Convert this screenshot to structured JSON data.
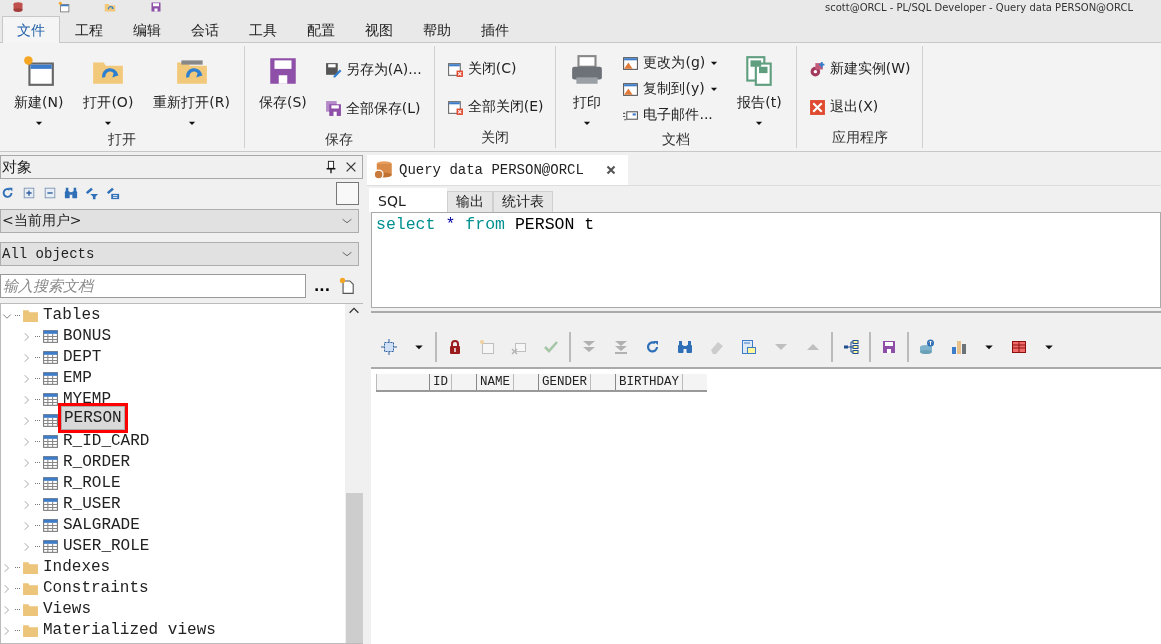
{
  "title_bar": {
    "title": "scott@ORCL - PL/SQL Developer - Query data PERSON@ORCL"
  },
  "menu_tabs": [
    {
      "label": "文件",
      "selected": true
    },
    {
      "label": "工程",
      "selected": false
    },
    {
      "label": "编辑",
      "selected": false
    },
    {
      "label": "会话",
      "selected": false
    },
    {
      "label": "工具",
      "selected": false
    },
    {
      "label": "配置",
      "selected": false
    },
    {
      "label": "视图",
      "selected": false
    },
    {
      "label": "帮助",
      "selected": false
    },
    {
      "label": "插件",
      "selected": false
    }
  ],
  "ribbon": [
    {
      "label": "打开",
      "items": [
        {
          "kind": "large",
          "label": "新建(N)",
          "dropdown": true
        },
        {
          "kind": "large",
          "label": "打开(O)",
          "dropdown": true
        },
        {
          "kind": "large",
          "label": "重新打开(R)",
          "dropdown": true
        }
      ]
    },
    {
      "label": "保存",
      "items": [
        {
          "kind": "large",
          "label": "保存(S)",
          "dropdown": false
        },
        {
          "kind": "stack",
          "items": [
            {
              "label": "另存为(A)...",
              "dropdown": false
            },
            {
              "label": "全部保存(L)",
              "dropdown": false
            }
          ]
        }
      ]
    },
    {
      "label": "关闭",
      "items": [
        {
          "kind": "stack",
          "items": [
            {
              "label": "关闭(C)",
              "dropdown": false
            },
            {
              "label": "全部关闭(E)",
              "dropdown": false
            }
          ]
        }
      ]
    },
    {
      "label": "文档",
      "items": [
        {
          "kind": "large",
          "label": "打印",
          "dropdown": true
        },
        {
          "kind": "stack",
          "items": [
            {
              "label": "更改为(g)",
              "dropdown": true
            },
            {
              "label": "复制到(y)",
              "dropdown": true
            },
            {
              "label": "电子邮件...",
              "dropdown": false
            }
          ]
        },
        {
          "kind": "large",
          "label": "报告(t)",
          "dropdown": true
        }
      ]
    },
    {
      "label": "应用程序",
      "items": [
        {
          "kind": "stack",
          "items": [
            {
              "label": "新建实例(W)",
              "dropdown": false
            },
            {
              "label": "退出(X)",
              "dropdown": false
            }
          ]
        }
      ]
    }
  ],
  "object_panel": {
    "title": "对象",
    "toggle": {
      "checked": false
    },
    "owner_select": "<当前用户>",
    "type_select": "All objects",
    "search": {
      "placeholder": "输入搜索文档"
    },
    "more_button": "...",
    "tree": [
      {
        "label": "Tables",
        "kind": "folder",
        "expanded": true,
        "selected": false,
        "highlighted": false,
        "children": [
          {
            "label": "BONUS",
            "kind": "table",
            "expanded": false,
            "selected": false,
            "highlighted": false
          },
          {
            "label": "DEPT",
            "kind": "table",
            "expanded": false,
            "selected": false,
            "highlighted": false
          },
          {
            "label": "EMP",
            "kind": "table",
            "expanded": false,
            "selected": false,
            "highlighted": false
          },
          {
            "label": "MYEMP",
            "kind": "table",
            "expanded": false,
            "selected": false,
            "highlighted": false
          },
          {
            "label": "PERSON",
            "kind": "table",
            "expanded": false,
            "selected": true,
            "highlighted": true
          },
          {
            "label": "R_ID_CARD",
            "kind": "table",
            "expanded": false,
            "selected": false,
            "highlighted": false
          },
          {
            "label": "R_ORDER",
            "kind": "table",
            "expanded": false,
            "selected": false,
            "highlighted": false
          },
          {
            "label": "R_ROLE",
            "kind": "table",
            "expanded": false,
            "selected": false,
            "highlighted": false
          },
          {
            "label": "R_USER",
            "kind": "table",
            "expanded": false,
            "selected": false,
            "highlighted": false
          },
          {
            "label": "SALGRADE",
            "kind": "table",
            "expanded": false,
            "selected": false,
            "highlighted": false
          },
          {
            "label": "USER_ROLE",
            "kind": "table",
            "expanded": false,
            "selected": false,
            "highlighted": false
          }
        ]
      },
      {
        "label": "Indexes",
        "kind": "folder",
        "expanded": false,
        "selected": false,
        "highlighted": false
      },
      {
        "label": "Constraints",
        "kind": "folder",
        "expanded": false,
        "selected": false,
        "highlighted": false
      },
      {
        "label": "Views",
        "kind": "folder",
        "expanded": false,
        "selected": false,
        "highlighted": false
      },
      {
        "label": "Materialized views",
        "kind": "folder",
        "expanded": false,
        "selected": false,
        "highlighted": false
      }
    ]
  },
  "document_tab": {
    "title": "Query data PERSON@ORCL"
  },
  "sub_tabs": [
    {
      "label": "SQL",
      "selected": true
    },
    {
      "label": "输出",
      "selected": false
    },
    {
      "label": "统计表",
      "selected": false
    }
  ],
  "sql": [
    {
      "text": "select",
      "kind": "keyword"
    },
    {
      "text": "*",
      "kind": "operator"
    },
    {
      "text": "from",
      "kind": "keyword"
    },
    {
      "text": "PERSON",
      "kind": "identifier"
    },
    {
      "text": "t",
      "kind": "identifier"
    }
  ],
  "results_toolbar": [
    [
      {
        "disabled": false
      },
      {
        "disabled": false
      }
    ],
    [
      {
        "disabled": false
      },
      {
        "disabled": true
      },
      {
        "disabled": true
      },
      {
        "disabled": true
      }
    ],
    [
      {
        "disabled": true
      },
      {
        "disabled": true
      },
      {
        "disabled": false
      },
      {
        "disabled": false
      },
      {
        "disabled": true
      },
      {
        "disabled": false
      },
      {
        "disabled": true
      },
      {
        "disabled": true
      }
    ],
    [
      {
        "disabled": false
      }
    ],
    [
      {
        "disabled": false
      }
    ],
    [
      {
        "disabled": false
      },
      {
        "disabled": false
      },
      {
        "disabled": false
      },
      {
        "disabled": false
      },
      {
        "disabled": false
      }
    ]
  ],
  "grid": {
    "columns": [
      "ID",
      "NAME",
      "GENDER",
      "BIRTHDAY"
    ]
  }
}
